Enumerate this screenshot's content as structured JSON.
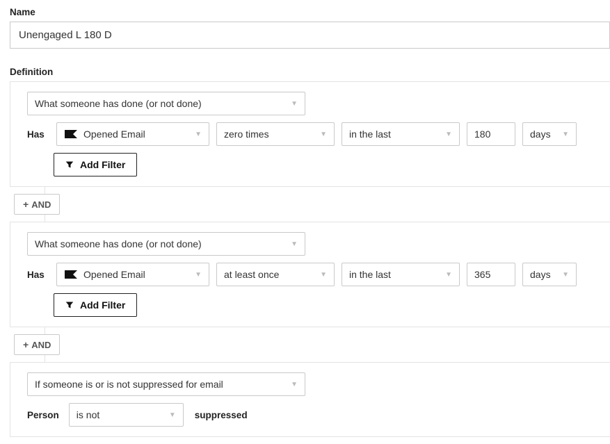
{
  "name_label": "Name",
  "name_value": "Unengaged L 180 D",
  "definition_label": "Definition",
  "and_label": "AND",
  "add_filter_label": "Add Filter",
  "blocks": {
    "0": {
      "type_label": "What someone has done (or not done)",
      "has_label": "Has",
      "event": "Opened Email",
      "frequency": "zero times",
      "timeframe": "in the last",
      "number": "180",
      "unit": "days"
    },
    "1": {
      "type_label": "What someone has done (or not done)",
      "has_label": "Has",
      "event": "Opened Email",
      "frequency": "at least once",
      "timeframe": "in the last",
      "number": "365",
      "unit": "days"
    },
    "2": {
      "type_label": "If someone is or is not suppressed for email",
      "person_label": "Person",
      "operator": "is not",
      "suppressed_label": "suppressed"
    }
  }
}
